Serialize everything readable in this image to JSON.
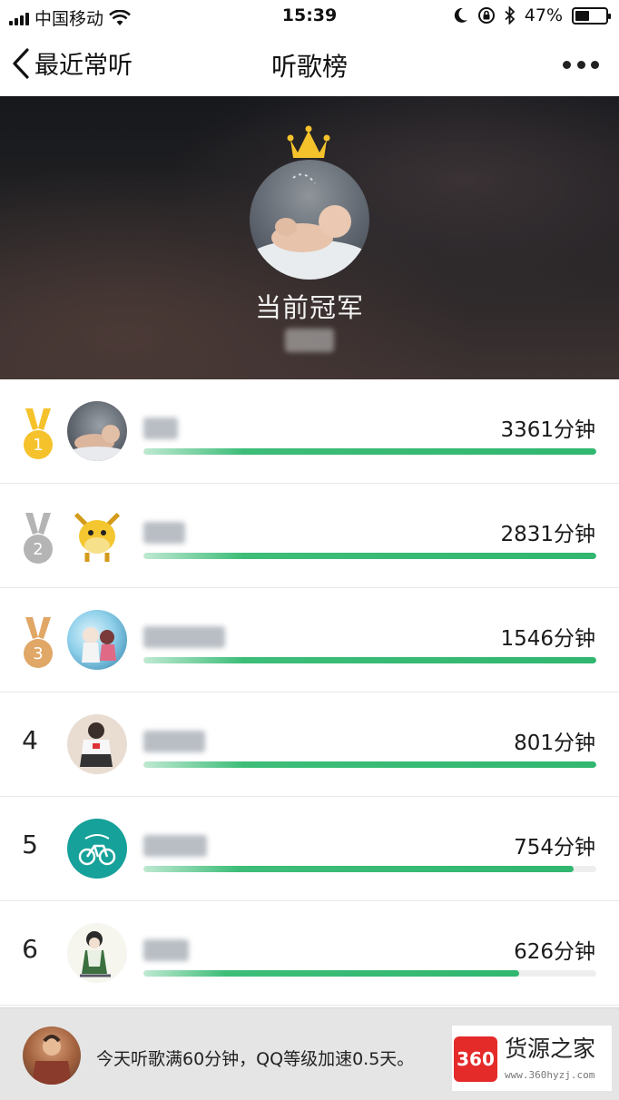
{
  "status_bar": {
    "carrier": "中国移动",
    "time": "15:39",
    "battery": "47%",
    "battery_level": 0.47,
    "icons": [
      "signal-icon",
      "wifi-icon",
      "moon-icon",
      "rotation-lock-icon",
      "bluetooth-icon",
      "battery-icon"
    ]
  },
  "nav": {
    "back_label": "最近常听",
    "title": "听歌榜",
    "more_icon": "more-icon"
  },
  "hero": {
    "title": "当前冠军",
    "crown_icon": "crown-icon"
  },
  "ranking": [
    {
      "rank": "1",
      "medal": "gold",
      "minutes": "3361分钟",
      "progress": 1.0
    },
    {
      "rank": "2",
      "medal": "silver",
      "minutes": "2831分钟",
      "progress": 1.0
    },
    {
      "rank": "3",
      "medal": "bronze",
      "minutes": "1546分钟",
      "progress": 1.0
    },
    {
      "rank": "4",
      "medal": "",
      "minutes": "801分钟",
      "progress": 1.0
    },
    {
      "rank": "5",
      "medal": "",
      "minutes": "754分钟",
      "progress": 0.95
    },
    {
      "rank": "6",
      "medal": "",
      "minutes": "626分钟",
      "progress": 0.83
    }
  ],
  "banner": {
    "text": "今天听歌满60分钟，QQ等级加速0.5天。"
  },
  "watermark": {
    "logo": "360",
    "title": "货源之家",
    "url": "www.360hyzj.com"
  },
  "colors": {
    "progress_green": "#31b770",
    "gold": "#f5c22b",
    "silver": "#b4b4b4",
    "bronze": "#e0a766",
    "watermark_red": "#e52a2a"
  }
}
